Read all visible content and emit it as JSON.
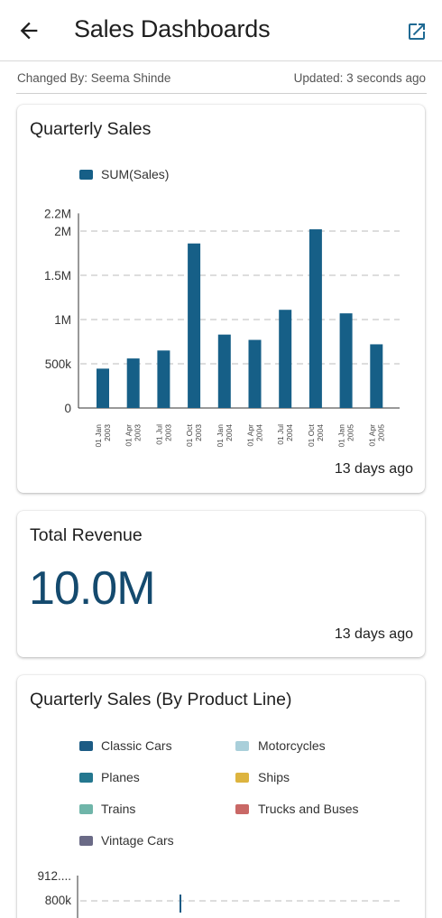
{
  "header": {
    "title": "Sales Dashboards",
    "back_icon": "arrow-left-icon",
    "open_icon": "open-external-icon"
  },
  "meta": {
    "changed_by": "Changed By: Seema Shinde",
    "updated": "Updated: 3 seconds ago"
  },
  "cards": {
    "quarterly_sales": {
      "title": "Quarterly Sales",
      "legend": "SUM(Sales)",
      "timestamp": "13 days ago"
    },
    "total_revenue": {
      "title": "Total Revenue",
      "value": "10.0M",
      "timestamp": "13 days ago"
    },
    "by_product_line": {
      "title": "Quarterly Sales (By Product Line)",
      "legend": [
        {
          "label": "Classic Cars",
          "color": "#1c5b84"
        },
        {
          "label": "Motorcycles",
          "color": "#a9cfda"
        },
        {
          "label": "Planes",
          "color": "#24778f"
        },
        {
          "label": "Ships",
          "color": "#ddb43f"
        },
        {
          "label": "Trains",
          "color": "#6fb5a9"
        },
        {
          "label": "Trucks and Buses",
          "color": "#c96866"
        },
        {
          "label": "Vintage Cars",
          "color": "#6a6a86"
        }
      ],
      "y_ticks": [
        "912....",
        "800k"
      ]
    }
  },
  "colors": {
    "bar": "#165f87",
    "big_number": "#144a6e"
  },
  "chart_data": [
    {
      "type": "bar",
      "title": "Quarterly Sales",
      "categories": [
        "01 Jan 2003",
        "01 Apr 2003",
        "01 Jul 2003",
        "01 Oct 2003",
        "01 Jan 2004",
        "01 Apr 2004",
        "01 Jul 2004",
        "01 Oct 2004",
        "01 Jan 2005",
        "01 Apr 2005"
      ],
      "series": [
        {
          "name": "SUM(Sales)",
          "values": [
            445000,
            560000,
            650000,
            1860000,
            830000,
            770000,
            1110000,
            2020000,
            1070000,
            720000
          ]
        }
      ],
      "y_ticks": [
        {
          "value": 0,
          "label": "0"
        },
        {
          "value": 500000,
          "label": "500k"
        },
        {
          "value": 1000000,
          "label": "1M"
        },
        {
          "value": 1500000,
          "label": "1.5M"
        },
        {
          "value": 2000000,
          "label": "2M"
        },
        {
          "value": 2200000,
          "label": "2.2M"
        }
      ],
      "ylim": [
        0,
        2200000
      ],
      "grid": true,
      "legend": "top-left"
    }
  ]
}
